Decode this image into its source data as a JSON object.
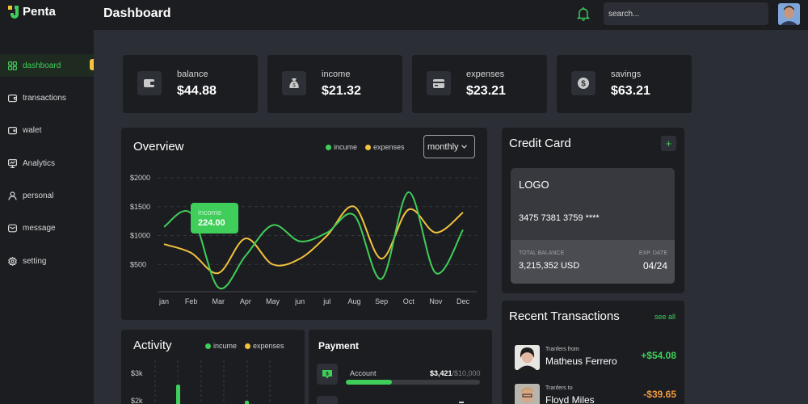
{
  "app": {
    "name": "Penta",
    "page_title": "Dashboard"
  },
  "colors": {
    "accent_green": "#3fce5a",
    "accent_yellow": "#f3c23c",
    "panel": "#1c1d21",
    "background": "#2b2e35",
    "expense_red": "#f39a3c"
  },
  "sidebar": {
    "items": [
      {
        "label": "dashboard",
        "icon": "grid-icon",
        "active": true
      },
      {
        "label": "transactions",
        "icon": "wallet-icon",
        "active": false
      },
      {
        "label": "walet",
        "icon": "wallet-card-icon",
        "active": false
      },
      {
        "label": "Analytics",
        "icon": "monitor-chart-icon",
        "active": false
      },
      {
        "label": "personal",
        "icon": "user-icon",
        "active": false
      },
      {
        "label": "message",
        "icon": "message-icon",
        "active": false
      },
      {
        "label": "setting",
        "icon": "gear-icon",
        "active": false
      }
    ]
  },
  "header": {
    "search_placeholder": "search..."
  },
  "stats": [
    {
      "label": "balance",
      "value": "$44.88",
      "icon": "wallet-icon"
    },
    {
      "label": "income",
      "value": "$21.32",
      "icon": "money-bag-icon"
    },
    {
      "label": "expenses",
      "value": "$23.21",
      "icon": "card-icon"
    },
    {
      "label": "savings",
      "value": "$63.21",
      "icon": "dollar-coin-icon"
    }
  ],
  "overview": {
    "title": "Overview",
    "legend_income": "incume",
    "legend_expenses": "expenses",
    "period": "monthly",
    "tooltip_label": "income",
    "tooltip_value": "224.00"
  },
  "chart_data": {
    "type": "line",
    "categories": [
      "jan",
      "Feb",
      "Mar",
      "Apr",
      "May",
      "jun",
      "jul",
      "Aug",
      "Sep",
      "Oct",
      "Nov",
      "Dec"
    ],
    "y_tick_labels": [
      "$2000",
      "$1500",
      "$1000",
      "$500"
    ],
    "y_ticks": [
      2000,
      1500,
      1000,
      500
    ],
    "ylim": [
      0,
      2000
    ],
    "grid": true,
    "legend_position": "top-right",
    "series": [
      {
        "name": "incume",
        "color": "#3fce5a",
        "values": [
          1150,
          1380,
          100,
          650,
          1180,
          900,
          1050,
          1350,
          250,
          1750,
          350,
          1100
        ]
      },
      {
        "name": "expenses",
        "color": "#f3c23c",
        "values": [
          850,
          700,
          350,
          950,
          500,
          600,
          1000,
          1500,
          600,
          1450,
          1050,
          1400
        ]
      }
    ]
  },
  "credit_card": {
    "title": "Credit Card",
    "add_label": "+",
    "logo": "LOGO",
    "number": "3475 7381 3759 ****",
    "balance_label": "TOTAL BALANCE",
    "balance": "3,215,352 USD",
    "exp_label": "EXP. DATE",
    "exp": "04/24"
  },
  "transactions": {
    "title": "Recent Transactions",
    "see_all": "see all",
    "items": [
      {
        "sub": "Tranfers from",
        "name": "Matheus Ferrero",
        "amount": "+$54.08",
        "color": "#3fce5a"
      },
      {
        "sub": "Tranfers to",
        "name": "Floyd Miles",
        "amount": "-$39.65",
        "color": "#f39a3c"
      }
    ]
  },
  "activity": {
    "title": "Activity",
    "legend_income": "incume",
    "legend_expenses": "expenses",
    "y_labels": [
      "$3k",
      "$2k"
    ]
  },
  "payment": {
    "title": "Payment",
    "account_label": "Account",
    "account_value": "$3,421",
    "account_max": "/$10,000",
    "progress": 0.3421
  }
}
